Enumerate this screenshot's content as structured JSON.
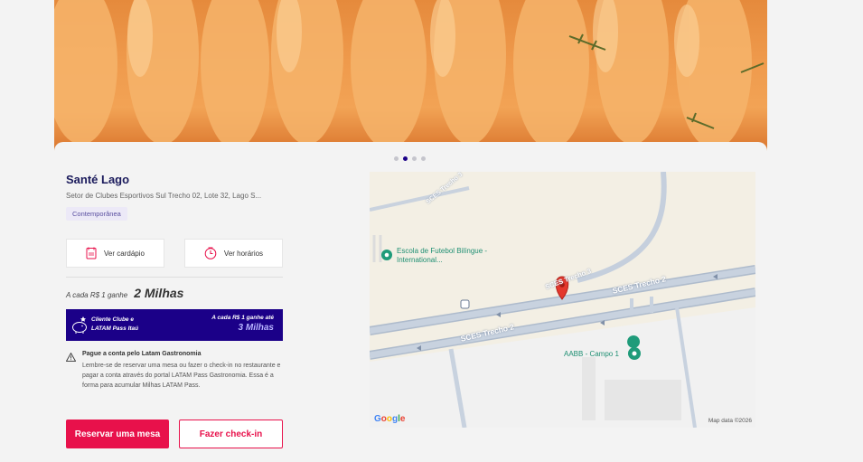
{
  "carousel": {
    "slides": 4,
    "active_index": 1
  },
  "restaurant": {
    "name": "Santé Lago",
    "address": "Setor de Clubes Esportivos Sul Trecho 02, Lote 32, Lago S...",
    "tag": "Contemporânea"
  },
  "actions": {
    "menu_label": "Ver cardápio",
    "hours_label": "Ver horários"
  },
  "miles": {
    "prefix": "A cada R$ 1 ganhe",
    "value": "2 Milhas"
  },
  "banner": {
    "left_text": "Cliente Clube e LATAM Pass Itaú",
    "right_prefix": "A cada R$ 1 ganhe até",
    "right_value": "3 Milhas"
  },
  "notice": {
    "title": "Pague a conta pelo Latam Gastronomia",
    "body": "Lembre-se de reservar uma mesa ou fazer o check-in no restaurante e pagar a conta através do portal LATAM Pass Gastronomia. Essa é a forma para acumular Milhas LATAM Pass."
  },
  "buttons": {
    "reserve": "Reservar uma mesa",
    "checkin": "Fazer check-in"
  },
  "map": {
    "school_label": "Escola de Futebol Bilíngue - International...",
    "aabb_label": "AABB - Campo 1",
    "road_1": "SCES Trecho 2",
    "road_2": "SCES Trecho 2",
    "road_3": "SCES Trecho 3",
    "road_4": "SCES Trecho 3",
    "attribution": "Map data ©2026",
    "logo": "Google"
  },
  "colors": {
    "brand_primary": "#e8114b",
    "brand_navy": "#1b0088"
  }
}
